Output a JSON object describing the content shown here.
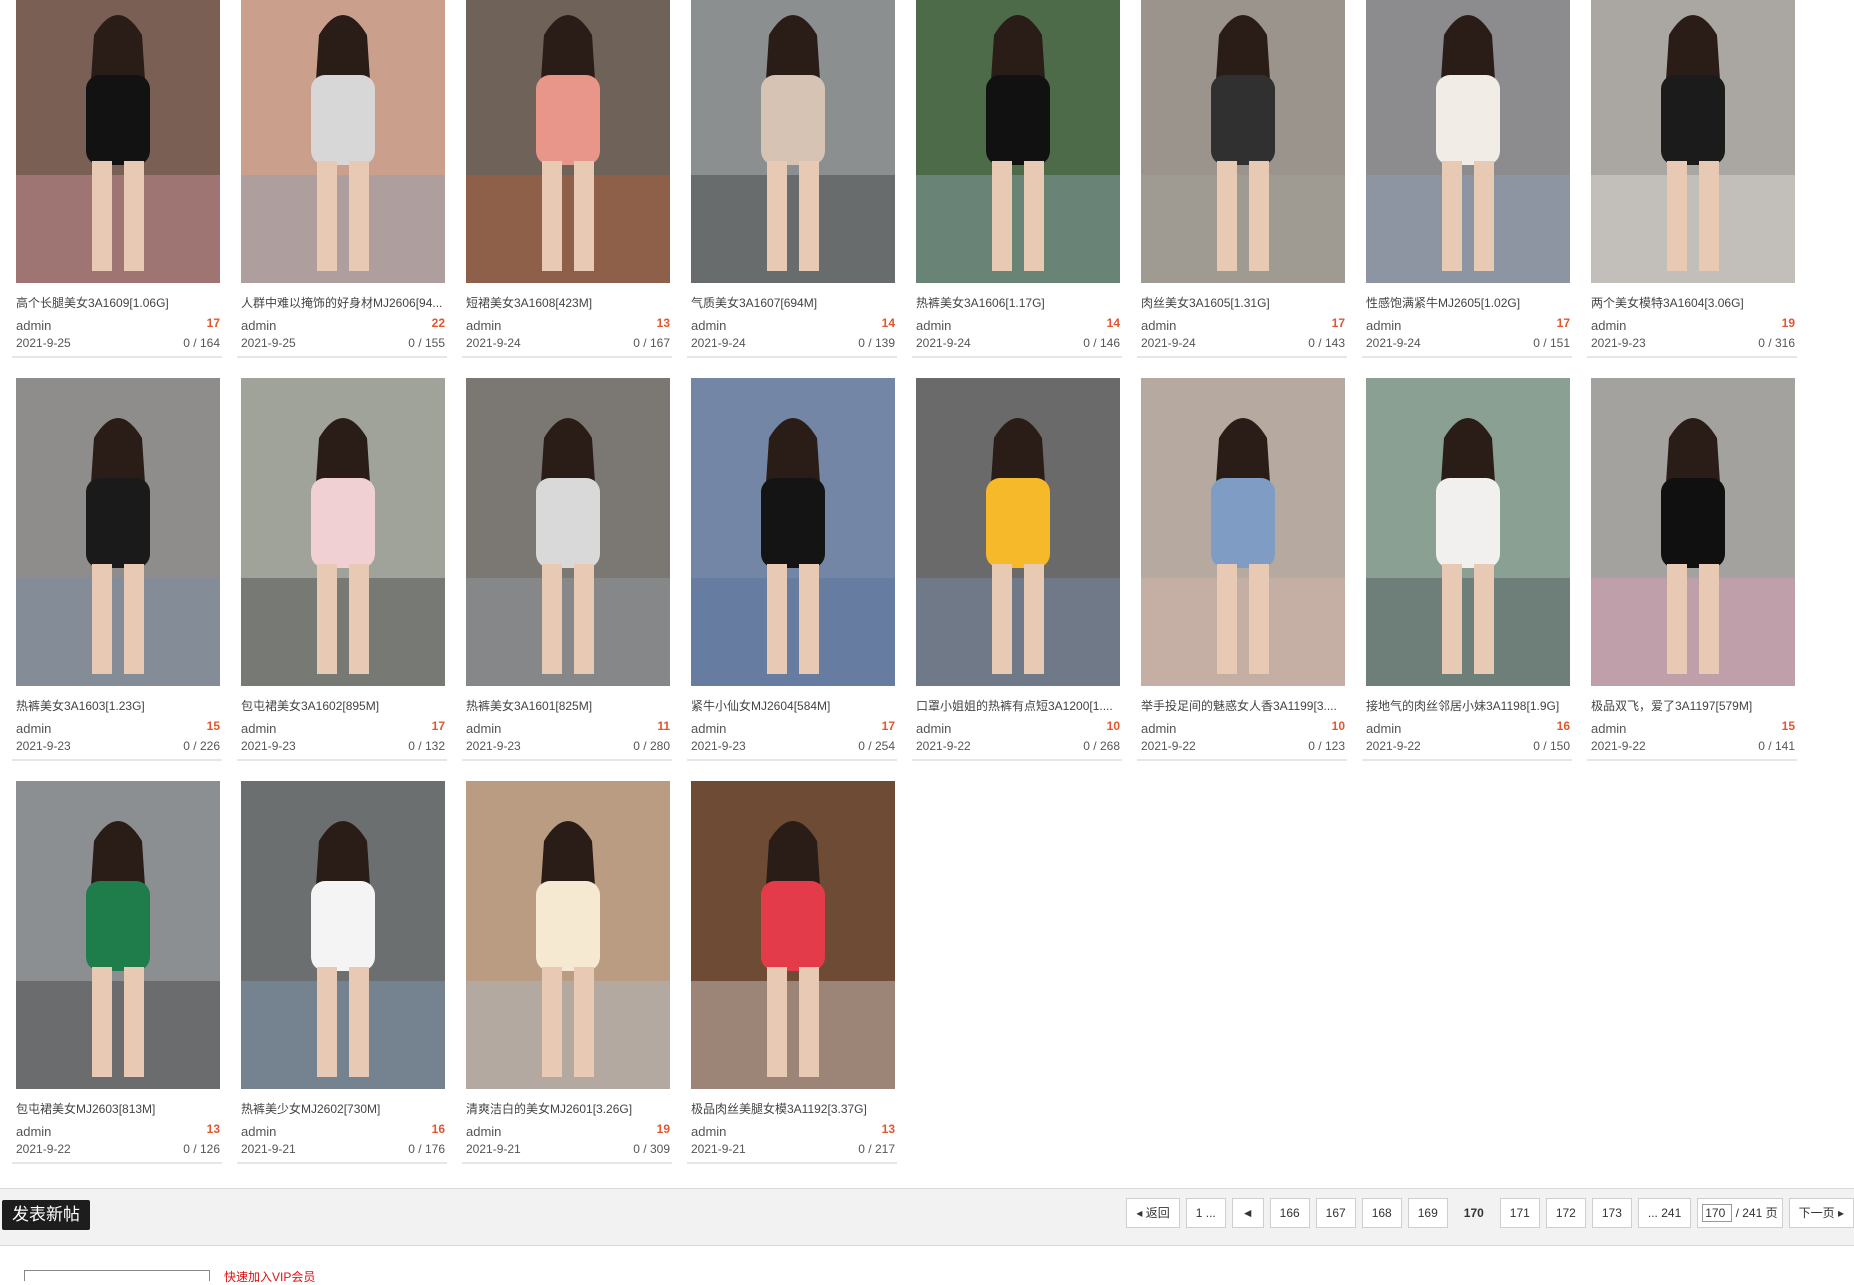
{
  "cards": [
    {
      "title": "高个长腿美女3A1609[1.06G]",
      "author": "admin",
      "count": "17",
      "date": "2021-9-25",
      "views": "0 / 164",
      "palette": [
        "#7a5f55",
        "#121212",
        "#e4a0b0"
      ]
    },
    {
      "title": "人群中难以掩饰的好身材MJ2606[94...",
      "author": "admin",
      "count": "22",
      "date": "2021-9-25",
      "views": "0 / 155",
      "palette": [
        "#caa08d",
        "#d7d7d7",
        "#7d9bbf"
      ]
    },
    {
      "title": "短裙美女3A1608[423M]",
      "author": "admin",
      "count": "13",
      "date": "2021-9-24",
      "views": "0 / 167",
      "palette": [
        "#6f6359",
        "#e8968a",
        "#c95a2b"
      ]
    },
    {
      "title": "气质美女3A1607[694M]",
      "author": "admin",
      "count": "14",
      "date": "2021-9-24",
      "views": "0 / 139",
      "palette": [
        "#8b8f8f",
        "#d6c3b3",
        "#2b2b2b"
      ]
    },
    {
      "title": "热裤美女3A1606[1.17G]",
      "author": "admin",
      "count": "14",
      "date": "2021-9-24",
      "views": "0 / 146",
      "palette": [
        "#4d6b49",
        "#111111",
        "#9eb5cc"
      ]
    },
    {
      "title": "肉丝美女3A1605[1.31G]",
      "author": "admin",
      "count": "17",
      "date": "2021-9-24",
      "views": "0 / 143",
      "palette": [
        "#9a948d",
        "#303030",
        "#a8a8a0"
      ]
    },
    {
      "title": "性感饱满紧牛MJ2605[1.02G]",
      "author": "admin",
      "count": "17",
      "date": "2021-9-24",
      "views": "0 / 151",
      "palette": [
        "#8c8b8e",
        "#f2ece6",
        "#8fa8c8"
      ]
    },
    {
      "title": "两个美女模特3A1604[3.06G]",
      "author": "admin",
      "count": "19",
      "date": "2021-9-23",
      "views": "0 / 316",
      "palette": [
        "#aaa7a3",
        "#1b1b1b",
        "#f1efe9"
      ]
    },
    {
      "title": "热裤美女3A1603[1.23G]",
      "author": "admin",
      "count": "15",
      "date": "2021-9-23",
      "views": "0 / 226",
      "palette": [
        "#8f8d8b",
        "#1a1a1a",
        "#6f8fb0"
      ]
    },
    {
      "title": "包屯裙美女3A1602[895M]",
      "author": "admin",
      "count": "17",
      "date": "2021-9-23",
      "views": "0 / 132",
      "palette": [
        "#9fa39a",
        "#f0d0d2",
        "#2d2d2d"
      ]
    },
    {
      "title": "热裤美女3A1601[825M]",
      "author": "admin",
      "count": "11",
      "date": "2021-9-23",
      "views": "0 / 280",
      "palette": [
        "#7b7772",
        "#d9d9d9",
        "#9aa7b3"
      ]
    },
    {
      "title": "紧牛小仙女MJ2604[584M]",
      "author": "admin",
      "count": "17",
      "date": "2021-9-23",
      "views": "0 / 254",
      "palette": [
        "#7486a6",
        "#141414",
        "#4d6e99"
      ]
    },
    {
      "title": "口罩小姐姐的热裤有点短3A1200[1....",
      "author": "admin",
      "count": "10",
      "date": "2021-9-22",
      "views": "0 / 268",
      "palette": [
        "#6a6a6a",
        "#f5b929",
        "#7995bf"
      ]
    },
    {
      "title": "举手投足间的魅惑女人香3A1199[3....",
      "author": "admin",
      "count": "10",
      "date": "2021-9-22",
      "views": "0 / 123",
      "palette": [
        "#b6aaa0",
        "#7f9dc4",
        "#e3b8a8"
      ]
    },
    {
      "title": "接地气的肉丝邻居小妹3A1198[1.9G]",
      "author": "admin",
      "count": "16",
      "date": "2021-9-22",
      "views": "0 / 150",
      "palette": [
        "#8aa093",
        "#f1f0ee",
        "#3a3f47"
      ]
    },
    {
      "title": "极品双飞，爱了3A1197[579M]",
      "author": "admin",
      "count": "15",
      "date": "2021-9-22",
      "views": "0 / 141",
      "palette": [
        "#a4a29e",
        "#101010",
        "#f39ac0"
      ]
    },
    {
      "title": "包屯裙美女MJ2603[813M]",
      "author": "admin",
      "count": "13",
      "date": "2021-9-22",
      "views": "0 / 126",
      "palette": [
        "#8b8f92",
        "#1f7d4c",
        "#302a27"
      ]
    },
    {
      "title": "热裤美少女MJ2602[730M]",
      "author": "admin",
      "count": "16",
      "date": "2021-9-21",
      "views": "0 / 176",
      "palette": [
        "#6b6f70",
        "#f4f4f4",
        "#8aa9cc"
      ]
    },
    {
      "title": "清爽洁白的美女MJ2601[3.26G]",
      "author": "admin",
      "count": "19",
      "date": "2021-9-21",
      "views": "0 / 309",
      "palette": [
        "#b99c82",
        "#f6e9d2",
        "#a9c3d9"
      ]
    },
    {
      "title": "极品肉丝美腿女模3A1192[3.37G]",
      "author": "admin",
      "count": "13",
      "date": "2021-9-21",
      "views": "0 / 217",
      "palette": [
        "#6d4b35",
        "#e43b4a",
        "#f3f3f3"
      ]
    }
  ],
  "toolbar": {
    "new_post": "发表新帖"
  },
  "pager": {
    "back": "返回",
    "first": "1 ...",
    "prev": "◄",
    "pages": [
      "166",
      "167",
      "168",
      "169"
    ],
    "current": "170",
    "after": [
      "171",
      "172",
      "173"
    ],
    "last": "... 241",
    "input_value": "170",
    "total": "/ 241 页",
    "next": "下一页"
  },
  "footer": {
    "notice": "快速加入VIP会员"
  }
}
